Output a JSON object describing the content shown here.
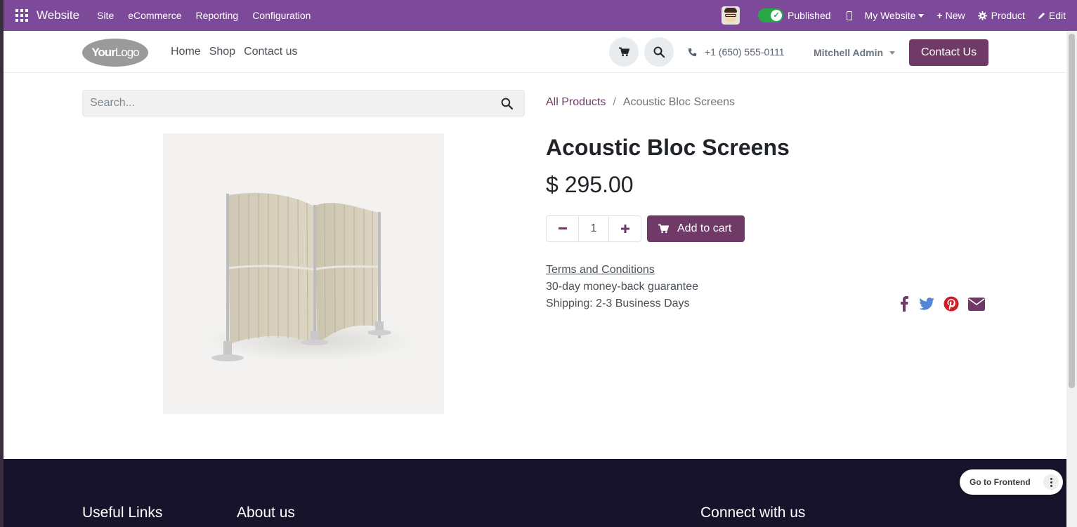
{
  "admin_bar": {
    "app_name": "Website",
    "menu": [
      {
        "label": "Site"
      },
      {
        "label": "eCommerce"
      },
      {
        "label": "Reporting"
      },
      {
        "label": "Configuration"
      }
    ],
    "published_label": "Published",
    "published_state": true,
    "website_selector": "My Website",
    "new_label": "New",
    "product_label": "Product",
    "edit_label": "Edit"
  },
  "header": {
    "logo_bold": "Your",
    "logo_light": "Logo",
    "nav": [
      {
        "label": "Home"
      },
      {
        "label": "Shop"
      },
      {
        "label": "Contact us"
      }
    ],
    "phone": "+1 (650) 555-0111",
    "user": "Mitchell Admin",
    "contact_button": "Contact Us"
  },
  "search": {
    "placeholder": "Search..."
  },
  "breadcrumb": {
    "parent": "All Products",
    "separator": "/",
    "current": "Acoustic Bloc Screens"
  },
  "product": {
    "title": "Acoustic Bloc Screens",
    "price": "$ 295.00",
    "quantity": "1",
    "add_to_cart": "Add to cart",
    "terms": "Terms and Conditions",
    "guarantee": "30-day money-back guarantee",
    "shipping": "Shipping: 2-3 Business Days"
  },
  "share_icons": [
    {
      "name": "facebook-icon",
      "color": "#3b5998"
    },
    {
      "name": "twitter-icon",
      "color": "#55acee"
    },
    {
      "name": "pinterest-icon",
      "color": "#cb2027"
    },
    {
      "name": "email-icon",
      "color": "#6f3b66"
    }
  ],
  "footer": {
    "col1": "Useful Links",
    "col2": "About us",
    "col3": "Connect with us"
  },
  "floating": {
    "go_frontend": "Go to Frontend"
  },
  "colors": {
    "admin_bar": "#7c4a98",
    "brand": "#6f3b66",
    "footer": "#17132b",
    "published_toggle": "#28a745"
  }
}
